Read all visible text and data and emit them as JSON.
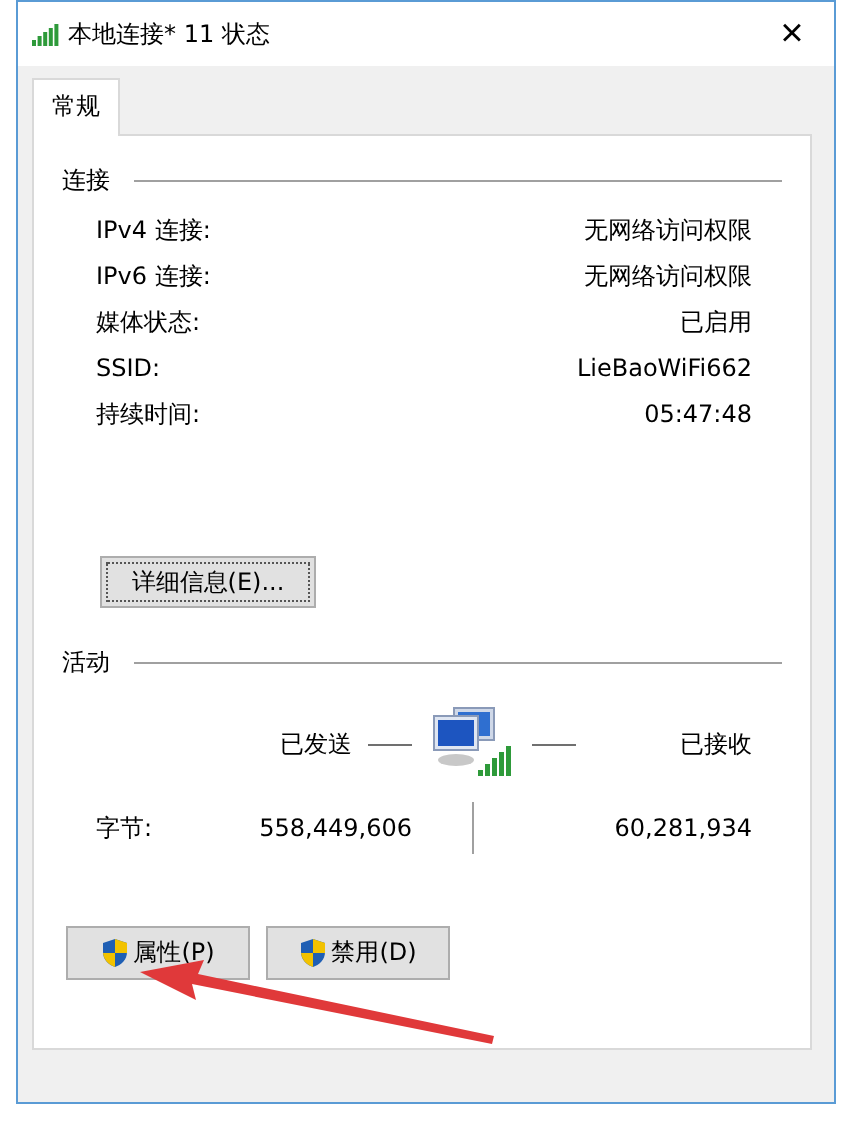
{
  "window": {
    "title": "本地连接* 11 状态",
    "close": "×"
  },
  "tabs": [
    {
      "label": "常规",
      "selected": true
    }
  ],
  "connection": {
    "heading": "连接",
    "rows": [
      {
        "label": "IPv4 连接:",
        "value": "无网络访问权限"
      },
      {
        "label": "IPv6 连接:",
        "value": "无网络访问权限"
      },
      {
        "label": "媒体状态:",
        "value": "已启用"
      },
      {
        "label": "SSID:",
        "value": "LieBaoWiFi662"
      },
      {
        "label": "持续时间:",
        "value": "05:47:48"
      }
    ],
    "details_button": "详细信息(E)..."
  },
  "activity": {
    "heading": "活动",
    "sent_label": "已发送",
    "received_label": "已接收",
    "bytes_label": "字节:",
    "sent": "558,449,606",
    "received": "60,281,934"
  },
  "buttons": [
    {
      "label": "属性(P)",
      "shield": true
    },
    {
      "label": "禁用(D)",
      "shield": true
    }
  ]
}
